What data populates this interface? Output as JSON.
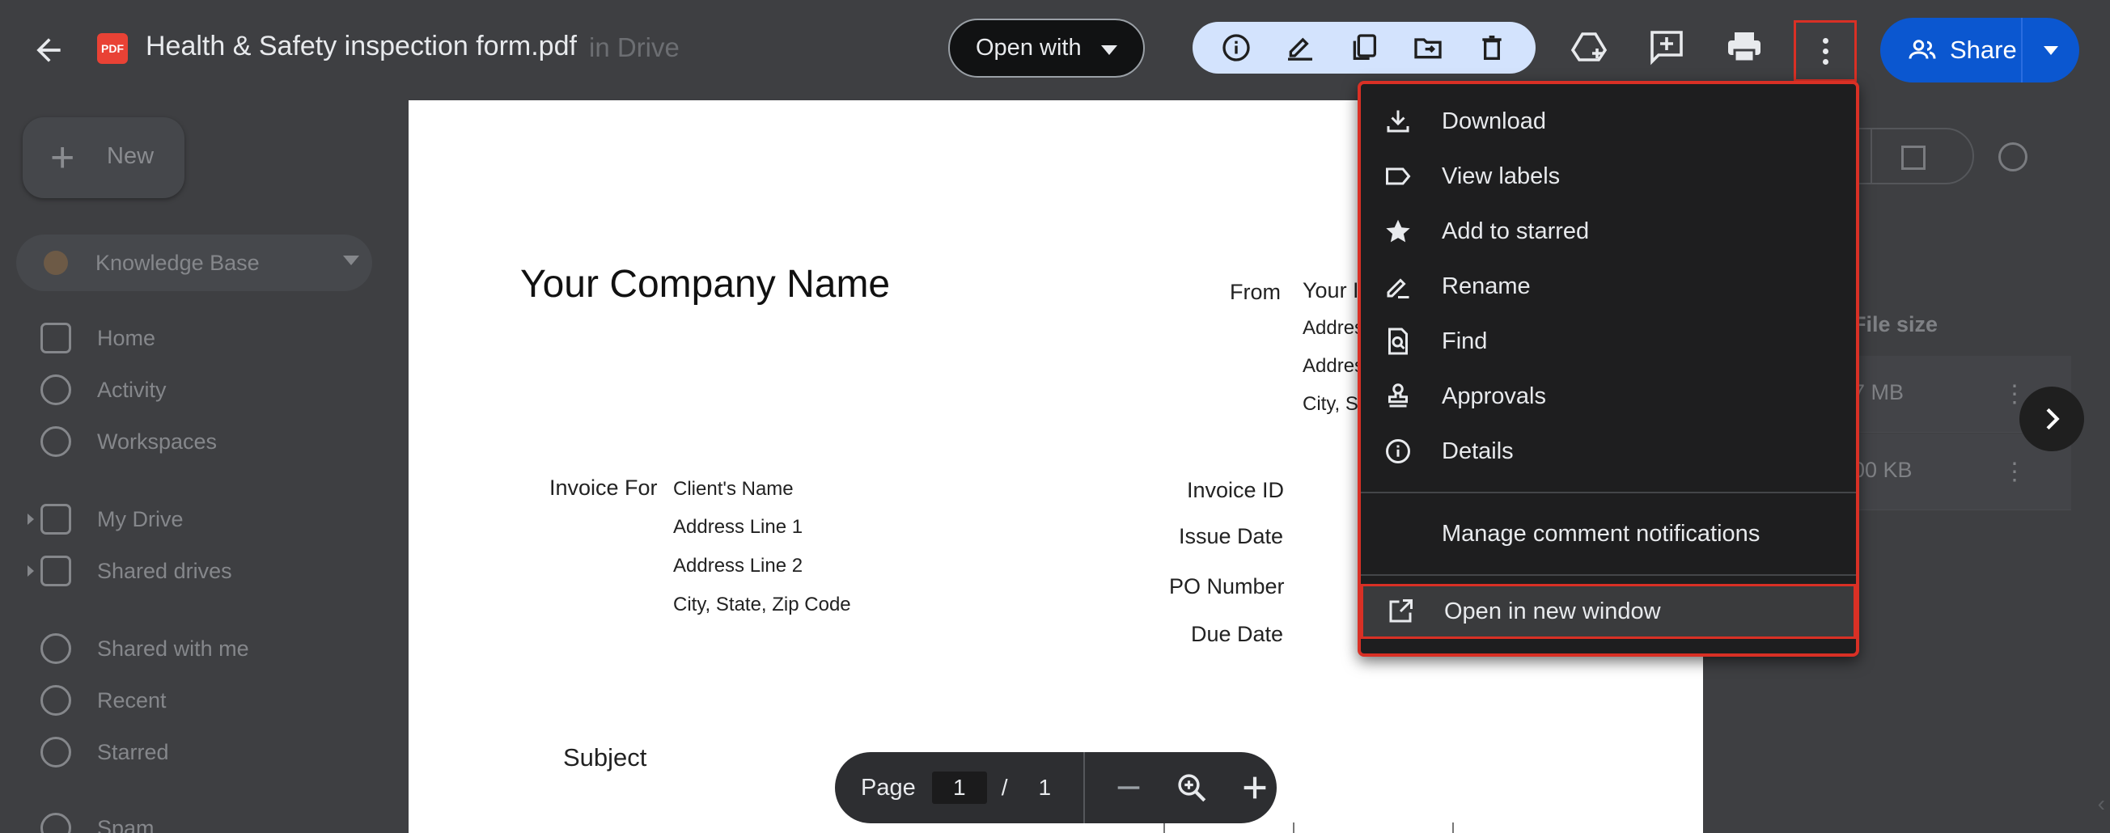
{
  "viewer": {
    "file_title": "Health & Safety inspection form.pdf",
    "file_badge": "PDF",
    "behind_title_text": "in Drive",
    "open_with_label": "Open with",
    "share_label": "Share"
  },
  "menu": {
    "items": [
      {
        "label": "Download",
        "icon": "download-icon"
      },
      {
        "label": "View labels",
        "icon": "label-icon"
      },
      {
        "label": "Add to starred",
        "icon": "star-icon"
      },
      {
        "label": "Rename",
        "icon": "rename-icon"
      },
      {
        "label": "Find",
        "icon": "find-icon"
      },
      {
        "label": "Approvals",
        "icon": "approvals-icon"
      },
      {
        "label": "Details",
        "icon": "info-icon"
      }
    ],
    "manage_notifications": "Manage comment notifications",
    "open_new_window": "Open in new window"
  },
  "pdf": {
    "company_name": "Your Company Name",
    "from_label": "From",
    "from_lines": [
      "Your I",
      "Addres",
      "Addres",
      "City, S"
    ],
    "invoice_for_label": "Invoice For",
    "client_lines": [
      "Client's Name",
      "Address Line 1",
      "Address Line 2",
      "City, State, Zip Code"
    ],
    "fields": [
      "Invoice ID",
      "Issue Date",
      "PO Number",
      "Due Date"
    ],
    "subject_label": "Subject"
  },
  "page_controls": {
    "page_label": "Page",
    "current_page": "1",
    "separator": "/",
    "total_pages": "1"
  },
  "background": {
    "new_label": "New",
    "kb_label": "Knowledge Base",
    "nav": [
      "Home",
      "Activity",
      "Workspaces",
      "My Drive",
      "Shared drives",
      "Shared with me",
      "Recent",
      "Starred",
      "Spam"
    ],
    "col_header": "File size",
    "rows": [
      "7 MB",
      "00 KB"
    ]
  },
  "colors": {
    "menu_highlight_border": "#d93025",
    "share_button": "#0b57d0",
    "tool_pill": "#d3e3fd",
    "pdf_badge": "#e94235"
  }
}
